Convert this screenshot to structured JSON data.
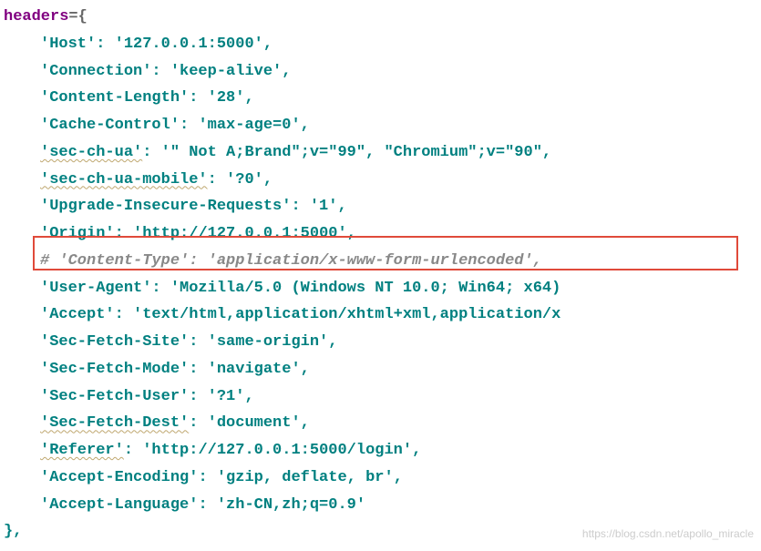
{
  "code": {
    "var_name": "headers",
    "open": "={",
    "close": "},",
    "entries": [
      {
        "key": "'Host'",
        "key_wavy": false,
        "sep": ": ",
        "val": "'127.0.0.1:5000'",
        "trail": ","
      },
      {
        "key": "'Connection'",
        "key_wavy": false,
        "sep": ": ",
        "val": "'keep-alive'",
        "trail": ","
      },
      {
        "key": "'Content-Length'",
        "key_wavy": false,
        "sep": ": ",
        "val": "'28'",
        "trail": ","
      },
      {
        "key": "'Cache-Control'",
        "key_wavy": false,
        "sep": ": ",
        "val": "'max-age=0'",
        "trail": ","
      },
      {
        "key": "'sec-ch-ua'",
        "key_wavy": true,
        "sep": ": ",
        "val": "'\" Not A;Brand\";v=\"99\", \"Chromium\";v=\"90\",",
        "trail": ""
      },
      {
        "key": "'sec-ch-ua-mobile'",
        "key_wavy": true,
        "sep": ": ",
        "val": "'?0'",
        "trail": ","
      },
      {
        "key": "'Upgrade-Insecure-Requests'",
        "key_wavy": false,
        "sep": ": ",
        "val": "'1'",
        "trail": ","
      },
      {
        "key": "'Origin'",
        "key_wavy": false,
        "sep": ": ",
        "val": "'http://127.0.0.1:5000'",
        "trail": ","
      },
      {
        "comment": "# 'Content-Type': 'application/x-www-form-urlencoded',"
      },
      {
        "key": "'User-Agent'",
        "key_wavy": false,
        "sep": ": ",
        "val": "'Mozilla/5.0 (Windows NT 10.0; Win64; x64)",
        "trail": ""
      },
      {
        "key": "'Accept'",
        "key_wavy": false,
        "sep": ": ",
        "val": "'text/html,application/xhtml+xml,application/x",
        "trail": ""
      },
      {
        "key": "'Sec-Fetch-Site'",
        "key_wavy": false,
        "sep": ": ",
        "val": "'same-origin'",
        "trail": ","
      },
      {
        "key": "'Sec-Fetch-Mode'",
        "key_wavy": false,
        "sep": ": ",
        "val": "'navigate'",
        "trail": ","
      },
      {
        "key": "'Sec-Fetch-User'",
        "key_wavy": false,
        "sep": ": ",
        "val": "'?1'",
        "trail": ","
      },
      {
        "key": "'Sec-Fetch-Dest'",
        "key_wavy": true,
        "sep": ": ",
        "val": "'document'",
        "trail": ","
      },
      {
        "key": "'Referer'",
        "key_wavy": true,
        "sep": ": ",
        "val": "'http://127.0.0.1:5000/login'",
        "trail": ","
      },
      {
        "key": "'Accept-Encoding'",
        "key_wavy": false,
        "sep": ": ",
        "val": "'gzip, deflate, br'",
        "trail": ","
      },
      {
        "key": "'Accept-Language'",
        "key_wavy": false,
        "sep": ": ",
        "val": "'zh-CN,zh;q=0.9'",
        "trail": ""
      }
    ]
  },
  "watermark": "https://blog.csdn.net/apollo_miracle"
}
